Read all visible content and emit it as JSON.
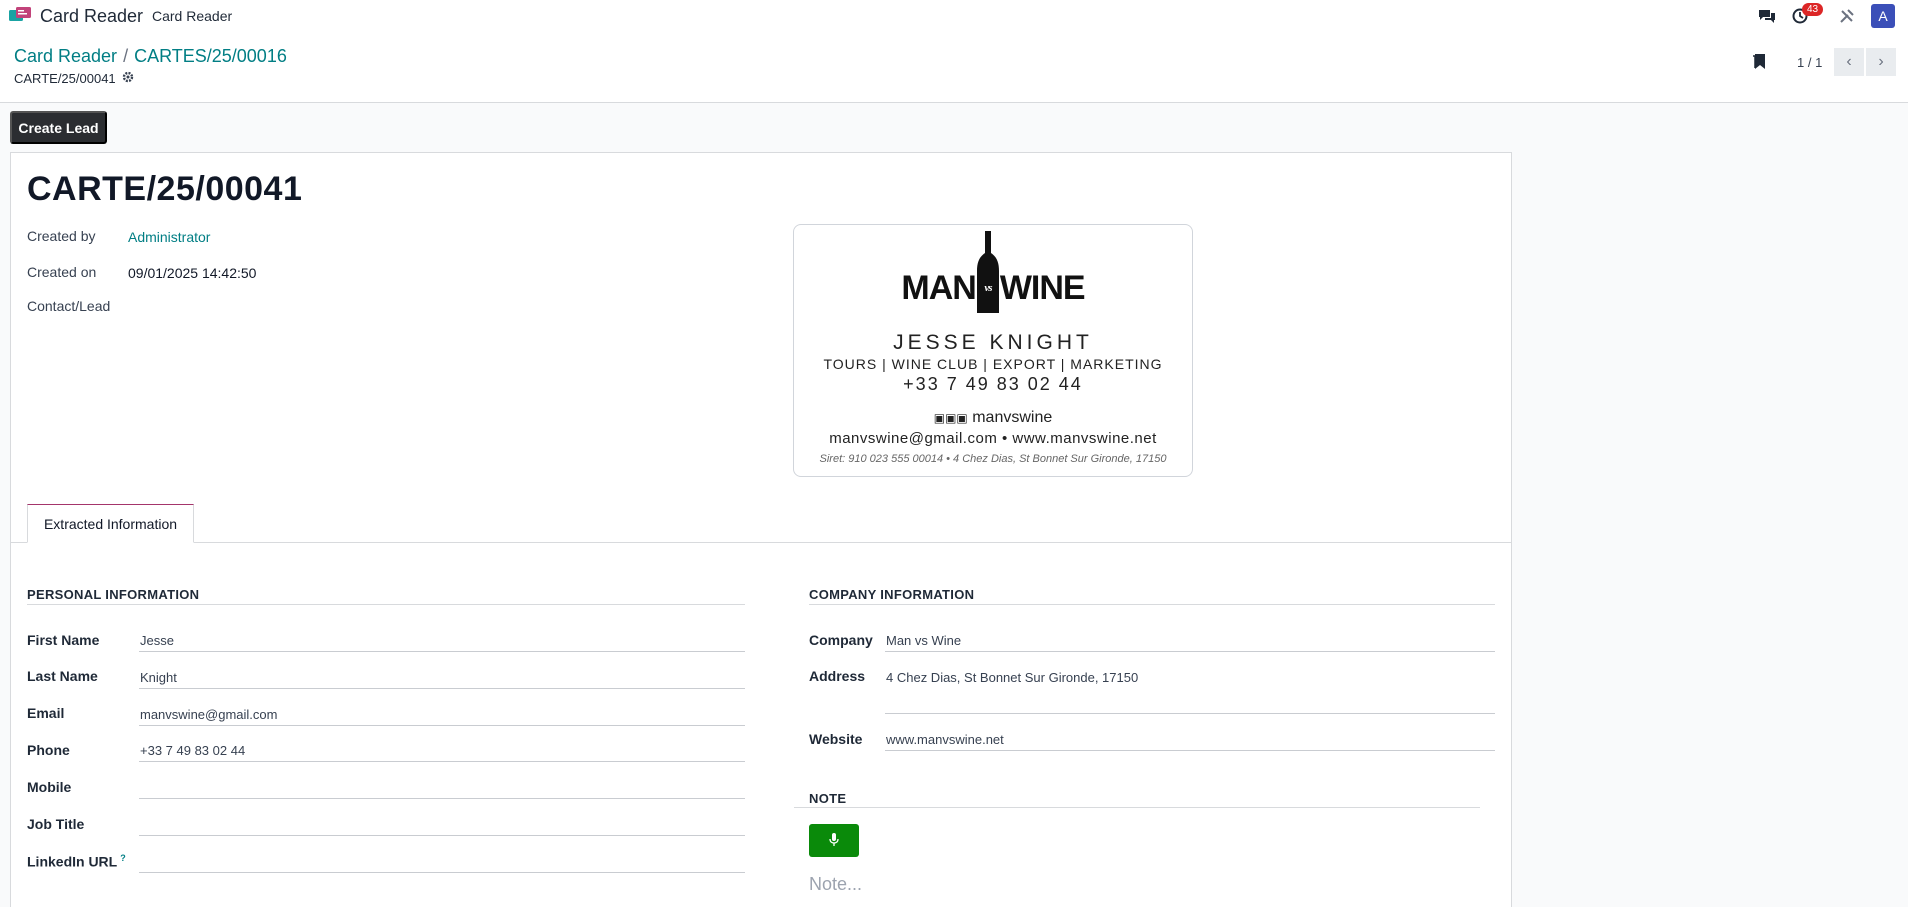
{
  "topnav": {
    "app_name": "Card Reader",
    "menu_item": "Card Reader",
    "badge_count": "43",
    "avatar_letter": "A"
  },
  "breadcrumb": {
    "parent": "Card Reader",
    "current": "CARTES/25/00016",
    "sub_record": "CARTE/25/00041"
  },
  "pager": {
    "text": "1 / 1"
  },
  "actions": {
    "create_lead": "Create Lead"
  },
  "record": {
    "title": "CARTE/25/00041",
    "created_by_label": "Created by",
    "created_by_value": "Administrator",
    "created_on_label": "Created on",
    "created_on_value": "09/01/2025 14:42:50",
    "contact_label": "Contact/Lead"
  },
  "card_image": {
    "brand_left": "MAN",
    "brand_right": "WINE",
    "brand_mid": "vs",
    "name": "JESSE KNIGHT",
    "tagline": "TOURS | WINE CLUB | EXPORT | MARKETING",
    "phone": "+33 7 49 83 02 44",
    "social": "manvswine",
    "contact_line": "manvswine@gmail.com • www.manvswine.net",
    "siret_line": "Siret: 910 023 555 00014 • 4 Chez Dias, St Bonnet Sur Gironde, 17150"
  },
  "tabs": {
    "extracted": "Extracted Information"
  },
  "personal": {
    "title": "PERSONAL INFORMATION",
    "fields": [
      {
        "label": "First Name",
        "value": "Jesse"
      },
      {
        "label": "Last Name",
        "value": "Knight"
      },
      {
        "label": "Email",
        "value": "manvswine@gmail.com"
      },
      {
        "label": "Phone",
        "value": "+33 7 49 83 02 44"
      },
      {
        "label": "Mobile",
        "value": ""
      },
      {
        "label": "Job Title",
        "value": ""
      },
      {
        "label": "LinkedIn URL",
        "value": "",
        "help": "?"
      }
    ]
  },
  "company": {
    "title": "COMPANY INFORMATION",
    "company_label": "Company",
    "company_value": "Man vs Wine",
    "address_label": "Address",
    "address_value": "4 Chez Dias, St Bonnet Sur Gironde, 17150",
    "website_label": "Website",
    "website_value": "www.manvswine.net"
  },
  "note": {
    "title": "NOTE",
    "placeholder": "Note..."
  },
  "colors": {
    "brand_teal": "#017e84",
    "dark_button": "#2b2d31",
    "mic_green": "#0a8a0a",
    "badge_red": "#dc2626",
    "avatar_blue": "#3b4fb8"
  }
}
